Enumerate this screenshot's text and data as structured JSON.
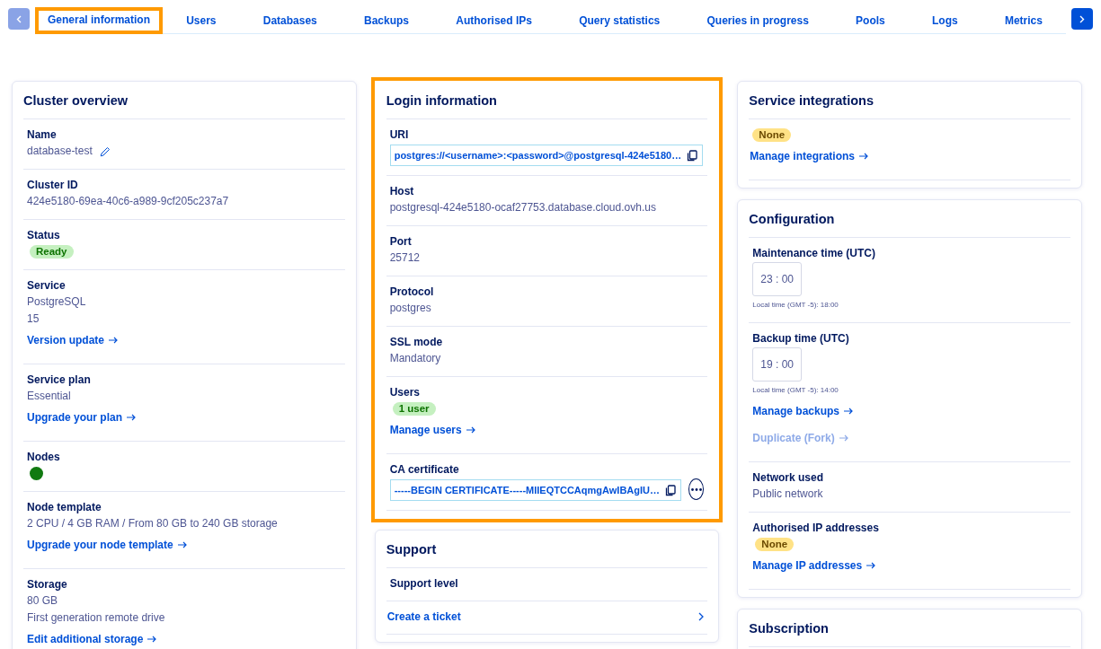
{
  "prev_button": {
    "disabled": true
  },
  "next_button": {
    "disabled": false
  },
  "tabs": [
    {
      "label": "General information",
      "selected": true,
      "highlighted": true
    },
    {
      "label": "Users",
      "selected": false,
      "highlighted": false
    },
    {
      "label": "Databases",
      "selected": false,
      "highlighted": false
    },
    {
      "label": "Backups",
      "selected": false,
      "highlighted": false
    },
    {
      "label": "Authorised IPs",
      "selected": false,
      "highlighted": false
    },
    {
      "label": "Query statistics",
      "selected": false,
      "highlighted": false
    },
    {
      "label": "Queries in progress",
      "selected": false,
      "highlighted": false
    },
    {
      "label": "Pools",
      "selected": false,
      "highlighted": false
    },
    {
      "label": "Logs",
      "selected": false,
      "highlighted": false
    },
    {
      "label": "Metrics",
      "selected": false,
      "highlighted": false
    }
  ],
  "columns": [
    [
      {
        "title": "Cluster overview",
        "highlighted": false,
        "sections": [
          {
            "label": "Name",
            "items": [
              {
                "kind": "text",
                "text": "database-test",
                "editable": true
              }
            ]
          },
          {
            "label": "Cluster ID",
            "items": [
              {
                "kind": "text",
                "text": "424e5180-69ea-40c6-a989-9cf205c237a7"
              }
            ]
          },
          {
            "label": "Status",
            "items": [
              {
                "kind": "badge",
                "text": "Ready",
                "color": "#c5f0c0"
              }
            ]
          },
          {
            "label": "Service",
            "items": [
              {
                "kind": "text",
                "text": "PostgreSQL"
              },
              {
                "kind": "text",
                "text": "15"
              },
              {
                "kind": "link",
                "text": "Version update",
                "disabled": false
              }
            ]
          },
          {
            "label": "Service plan",
            "items": [
              {
                "kind": "text",
                "text": "Essential"
              },
              {
                "kind": "link",
                "text": "Upgrade your plan",
                "disabled": false
              }
            ]
          },
          {
            "label": "Nodes",
            "items": [
              {
                "kind": "dot",
                "color": "#117a11"
              }
            ]
          },
          {
            "label": "Node template",
            "items": [
              {
                "kind": "text",
                "text": "2 CPU / 4 GB RAM / From 80 GB to 240 GB storage"
              },
              {
                "kind": "link",
                "text": "Upgrade your node template",
                "disabled": false
              }
            ]
          },
          {
            "label": "Storage",
            "items": [
              {
                "kind": "text",
                "text": "80 GB"
              },
              {
                "kind": "text",
                "text": "First generation remote drive"
              },
              {
                "kind": "link",
                "text": "Edit additional storage",
                "disabled": false
              }
            ]
          }
        ]
      }
    ],
    [
      {
        "title": "Login information",
        "highlighted": true,
        "sections": [
          {
            "label": "URI",
            "items": [
              {
                "kind": "copy",
                "value": "postgres://<username>:<password>@postgresql-424e5180…"
              }
            ]
          },
          {
            "label": "Host",
            "items": [
              {
                "kind": "text",
                "text": "postgresql-424e5180-ocaf27753.database.cloud.ovh.us"
              }
            ]
          },
          {
            "label": "Port",
            "items": [
              {
                "kind": "text",
                "text": "25712"
              }
            ]
          },
          {
            "label": "Protocol",
            "items": [
              {
                "kind": "text",
                "text": "postgres"
              }
            ]
          },
          {
            "label": "SSL mode",
            "items": [
              {
                "kind": "text",
                "text": "Mandatory"
              }
            ]
          },
          {
            "label": "Users",
            "items": [
              {
                "kind": "badge",
                "text": "1 user",
                "color": "#c5f0c0"
              },
              {
                "kind": "link",
                "text": "Manage users",
                "disabled": false
              }
            ]
          },
          {
            "label": "CA certificate",
            "items": [
              {
                "kind": "copy",
                "value": "-----BEGIN CERTIFICATE-----MIIEQTCCAqmgAwIBAgIU…",
                "more": true
              }
            ]
          }
        ]
      },
      {
        "title": "Support",
        "highlighted": false,
        "sections": [
          {
            "label": "Support level"
          },
          {
            "items": [
              {
                "kind": "row-link",
                "text": "Create a ticket"
              }
            ]
          }
        ]
      }
    ],
    [
      {
        "title": "Service integrations",
        "highlighted": false,
        "sections": [
          {
            "items": [
              {
                "kind": "badge",
                "text": "None",
                "color": "#ffe286"
              },
              {
                "kind": "link",
                "text": "Manage integrations",
                "disabled": false
              }
            ]
          }
        ]
      },
      {
        "title": "Configuration",
        "highlighted": false,
        "sections": [
          {
            "label": "Maintenance time (UTC)",
            "items": [
              {
                "kind": "time",
                "value": "23 : 00",
                "note": "Local time (GMT -5): 18:00"
              }
            ]
          },
          {
            "label": "Backup time (UTC)",
            "items": [
              {
                "kind": "time",
                "value": "19 : 00",
                "note": "Local time (GMT -5): 14:00"
              },
              {
                "kind": "link",
                "text": "Manage backups",
                "disabled": false
              },
              {
                "kind": "link",
                "text": "Duplicate (Fork)",
                "disabled": true
              }
            ]
          },
          {
            "label": "Network used",
            "items": [
              {
                "kind": "text",
                "text": "Public network"
              }
            ]
          },
          {
            "label": "Authorised IP addresses",
            "items": [
              {
                "kind": "badge",
                "text": "None",
                "color": "#ffe286"
              },
              {
                "kind": "link",
                "text": "Manage IP addresses",
                "disabled": false
              }
            ]
          }
        ]
      },
      {
        "title": "Subscription",
        "highlighted": false
      }
    ]
  ]
}
